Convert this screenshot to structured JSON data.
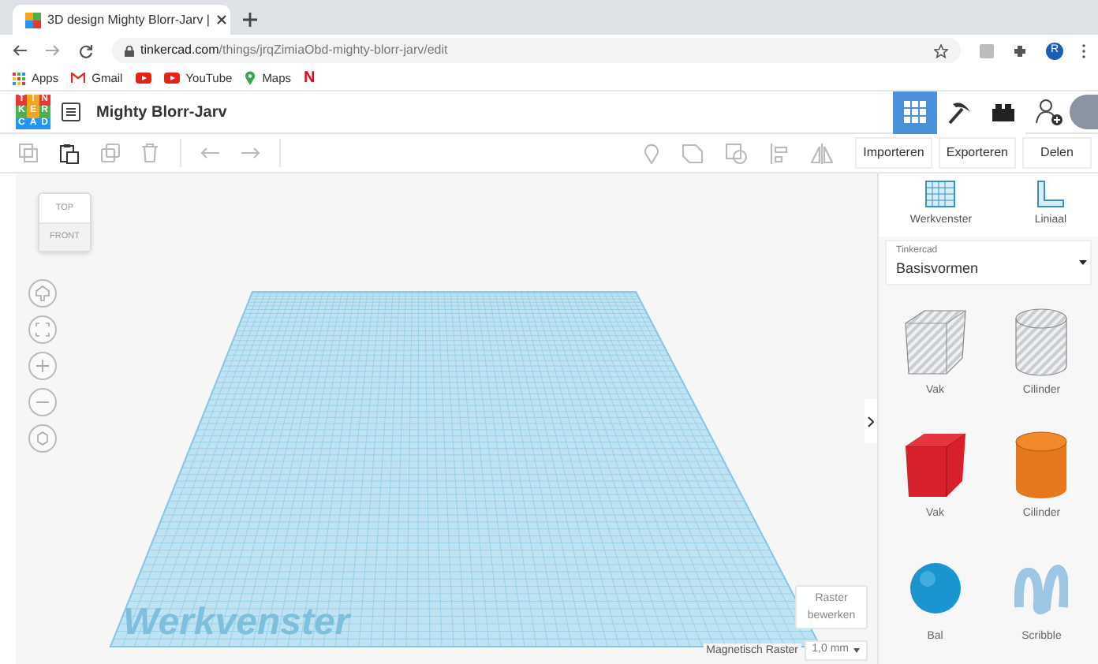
{
  "browser": {
    "tab_title": "3D design Mighty Blorr-Jarv |",
    "url_host": "tinkercad.com",
    "url_path": "/things/jrqZimiaObd-mighty-blorr-jarv/edit",
    "profile_initial": "R"
  },
  "bookmarks": [
    {
      "kind": "apps",
      "label": "Apps"
    },
    {
      "kind": "gmail",
      "label": "Gmail"
    },
    {
      "kind": "youtube"
    },
    {
      "kind": "youtube",
      "label": "YouTube"
    },
    {
      "kind": "maps",
      "label": "Maps"
    },
    {
      "kind": "netflix",
      "label": "N"
    }
  ],
  "app": {
    "logo_letters": [
      "T",
      "I",
      "N",
      "K",
      "E",
      "R",
      "C",
      "A",
      "D"
    ],
    "design_title": "Mighty Blorr-Jarv",
    "views": [
      {
        "kind": "grid",
        "selected": true
      },
      {
        "kind": "pickaxe",
        "selected": false
      },
      {
        "kind": "bricks",
        "selected": false
      }
    ]
  },
  "toolbar": {
    "actions": [
      "Importeren",
      "Exporteren",
      "Delen"
    ]
  },
  "viewcube": {
    "top": "TOP",
    "front": "FRONT"
  },
  "canvas": {
    "watermark": "Werkvenster",
    "edit_grid": "Raster bewerken",
    "snap_label": "Magnetisch Raster",
    "snap_value": "1,0 mm"
  },
  "panel": {
    "tools": [
      {
        "kind": "workplane",
        "label": "Werkvenster"
      },
      {
        "kind": "ruler",
        "label": "Liniaal"
      }
    ],
    "library_label": "Tinkercad",
    "library_value": "Basisvormen",
    "shapes": [
      {
        "kind": "box-hole",
        "name": "Vak",
        "color": "#c9ccd1"
      },
      {
        "kind": "cylinder-hole",
        "name": "Cilinder",
        "color": "#c9ccd1"
      },
      {
        "kind": "box",
        "name": "Vak",
        "color": "#d7202c"
      },
      {
        "kind": "cylinder",
        "name": "Cilinder",
        "color": "#e5781d"
      },
      {
        "kind": "sphere",
        "name": "Bal",
        "color": "#1b95d0"
      },
      {
        "kind": "scribble",
        "name": "Scribble",
        "color": "#9cc6e3"
      }
    ]
  }
}
